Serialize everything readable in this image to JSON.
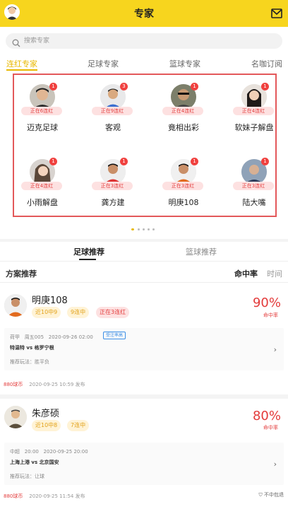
{
  "header": {
    "title": "专家"
  },
  "search": {
    "placeholder": "搜索专家"
  },
  "category_tabs": [
    "连红专家",
    "足球专家",
    "篮球专家",
    "名咖订阅"
  ],
  "experts": [
    {
      "name": "迈克足球",
      "badge": "1",
      "streak": "正在6连红"
    },
    {
      "name": "客观",
      "badge": "3",
      "streak": "正在9连红"
    },
    {
      "name": "竟相出彩",
      "badge": "1",
      "streak": "正在4连红"
    },
    {
      "name": "软妹子解盘",
      "badge": "1",
      "streak": "正在4连红"
    },
    {
      "name": "小雨解盘",
      "badge": "1",
      "streak": "正在4连红"
    },
    {
      "name": "龚方建",
      "badge": "1",
      "streak": "正在3连红"
    },
    {
      "name": "明庚108",
      "badge": "1",
      "streak": "正在3连红"
    },
    {
      "name": "陆大嘴",
      "badge": "1",
      "streak": "正在3连红"
    }
  ],
  "sub_tabs": [
    "足球推荐",
    "篮球推荐"
  ],
  "plan": {
    "title": "方案推荐",
    "sort_hit": "命中率",
    "sort_time": "时间"
  },
  "cards": [
    {
      "name": "明庚108",
      "pills": [
        "近10中9",
        "9连中",
        "正在3连红"
      ],
      "rate": "90%",
      "rate_label": "命中率",
      "league": "荷甲",
      "code": "周五005",
      "match_time": "2020-09-26 02:00",
      "tag": "受注率高",
      "teams": "特温特 vs 格罗宁根",
      "method": "推荐玩法：胜平负",
      "price": "880球币",
      "published": "2020-09-25 10:59 发布"
    },
    {
      "name": "朱彦硕",
      "pills": [
        "近10中8",
        "7连中"
      ],
      "rate": "80%",
      "rate_label": "命中率",
      "league": "中超",
      "code": "20:00",
      "match_time": "2020-09-25 20:00",
      "tag": "",
      "teams": "上海上港 vs 北京国安",
      "method": "推荐玩法：让球",
      "price": "880球币",
      "published": "2020-09-25 11:54 发布",
      "guarantee": "不中包退"
    }
  ],
  "colors": {
    "header_bg": "#f7d51e",
    "accent": "#e8b800",
    "red": "#e33b3b",
    "highlight_box": "#e3585a"
  }
}
